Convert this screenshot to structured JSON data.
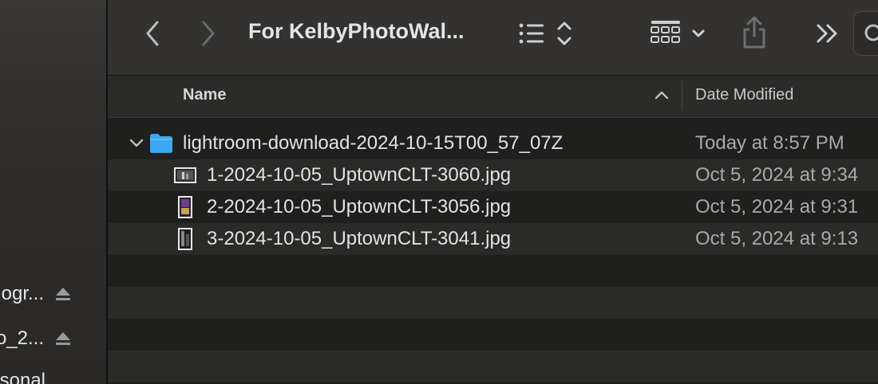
{
  "window": {
    "title": "For KelbyPhotoWal..."
  },
  "sidebar": {
    "items": [
      {
        "label": "ogr...",
        "eject": true
      },
      {
        "label": "o_2...",
        "eject": true
      },
      {
        "label": "sonal",
        "eject": false
      }
    ]
  },
  "toolbar": {
    "back": "back",
    "forward": "forward",
    "view_icon": "list-view-icon",
    "group_icon": "grid-group-icon",
    "share_icon": "share-icon",
    "more_icon": "double-chevron-icon",
    "search_icon": "search-icon"
  },
  "columns": {
    "name": "Name",
    "date": "Date Modified"
  },
  "files": [
    {
      "name": "lightroom-download-2024-10-15T00_57_07Z",
      "date": "Today at 8:57 PM",
      "kind": "folder",
      "expanded": true
    },
    {
      "name": "1-2024-10-05_UptownCLT-3060.jpg",
      "date": "Oct 5, 2024 at 9:34",
      "kind": "jpg-landscape"
    },
    {
      "name": "2-2024-10-05_UptownCLT-3056.jpg",
      "date": "Oct 5, 2024 at 9:31",
      "kind": "jpg-portrait"
    },
    {
      "name": "3-2024-10-05_UptownCLT-3041.jpg",
      "date": "Oct 5, 2024 at 9:13",
      "kind": "jpg-portrait"
    }
  ],
  "colors": {
    "folder": "#3aa7f0",
    "background": "#1e1e1e",
    "toolbar": "#333230"
  }
}
